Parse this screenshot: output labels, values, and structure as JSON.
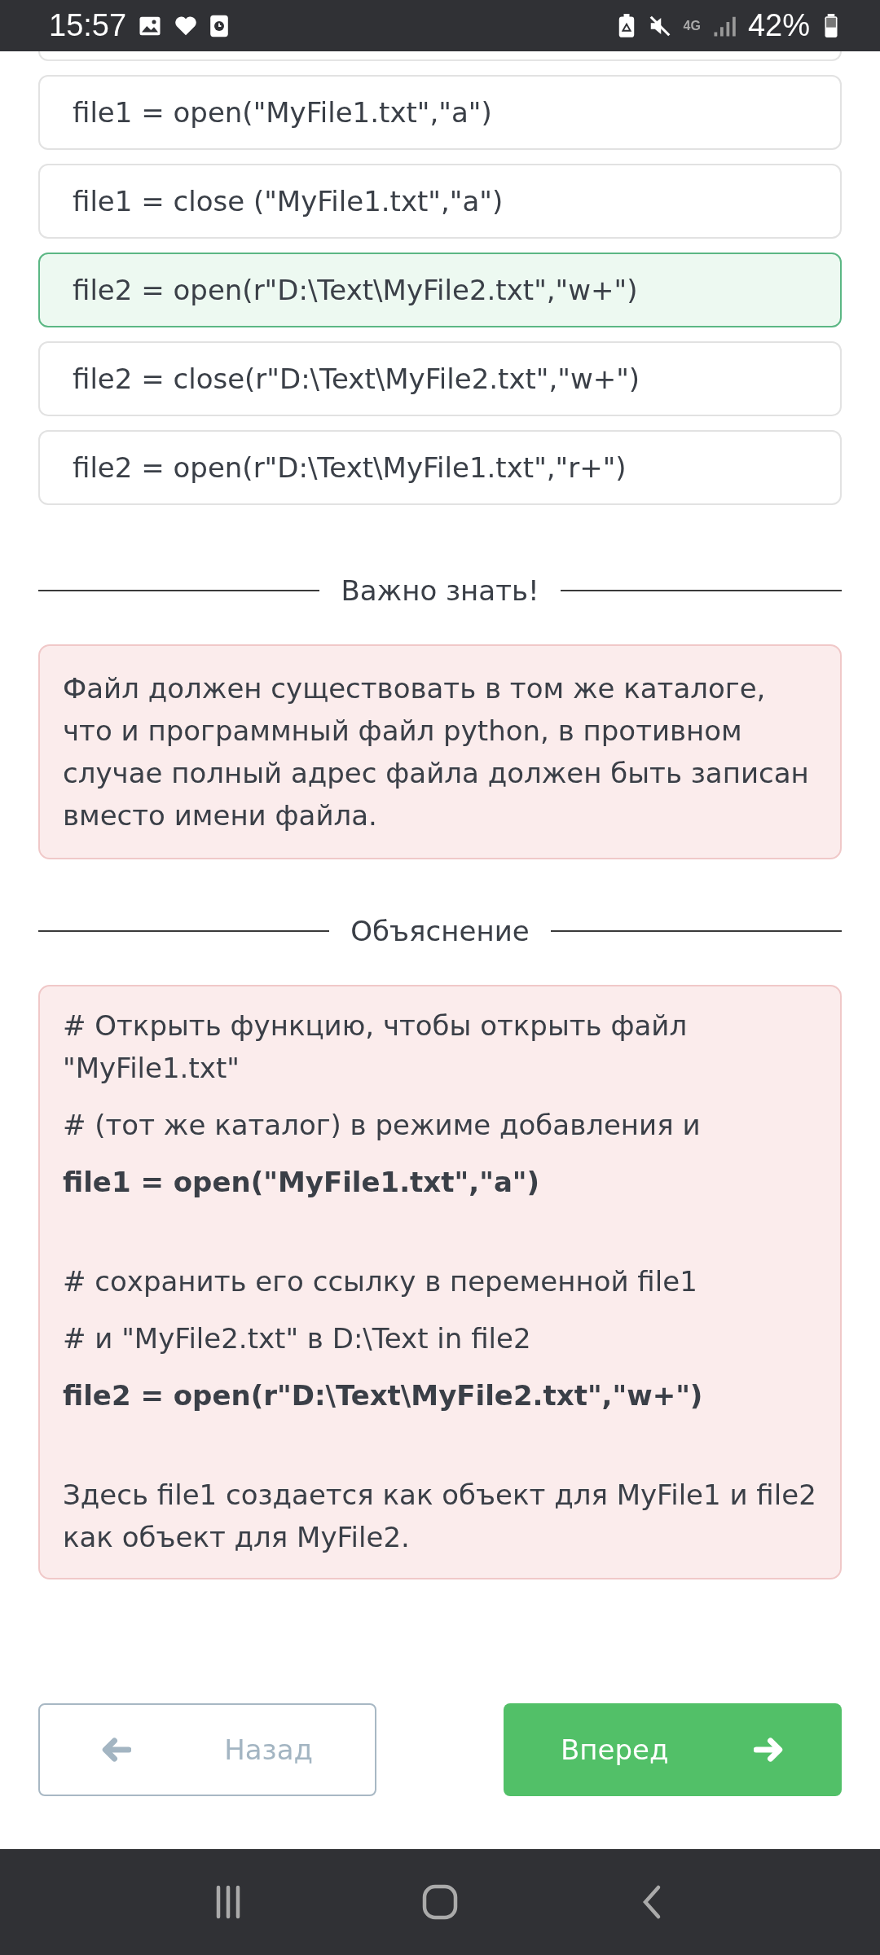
{
  "status_bar": {
    "time": "15:57",
    "network": "4G",
    "battery": "42%"
  },
  "options": [
    {
      "text": "file1 = open(\"MyFile1.txt\",\"a\")",
      "selected": false
    },
    {
      "text": "file1 = close (\"MyFile1.txt\",\"a\")",
      "selected": false
    },
    {
      "text": "file2 = open(r\"D:\\Text\\MyFile2.txt\",\"w+\")",
      "selected": true
    },
    {
      "text": "file2 = close(r\"D:\\Text\\MyFile2.txt\",\"w+\")",
      "selected": false
    },
    {
      "text": "file2 = open(r\"D:\\Text\\MyFile1.txt\",\"r+\")",
      "selected": false
    }
  ],
  "important": {
    "title": "Важно знать!",
    "text": "Файл должен существовать в том же каталоге, что и программный файл python, в противном случае полный адрес файла должен быть записан вместо имени файла."
  },
  "explanation": {
    "title": "Объяснение",
    "paragraphs": [
      [
        {
          "text": "# Открыть функцию, чтобы открыть файл \"MyFile1.txt\"",
          "kind": "comment"
        },
        {
          "text": "# (тот же каталог) в режиме добавления и",
          "kind": "comment"
        },
        {
          "text": "file1 = open(\"MyFile1.txt\",\"a\")",
          "kind": "code"
        }
      ],
      [
        {
          "text": "# сохранить его ссылку в переменной file1",
          "kind": "comment"
        },
        {
          "text": "# и \"MyFile2.txt\" в D:\\Text in file2",
          "kind": "comment"
        },
        {
          "text": "file2 = open(r\"D:\\Text\\MyFile2.txt\",\"w+\")",
          "kind": "code"
        }
      ],
      [
        {
          "text": "Здесь file1 создается как объект для MyFile1 и file2 как объект для MyFile2.",
          "kind": "comment"
        }
      ]
    ]
  },
  "buttons": {
    "back": "Назад",
    "next": "Вперед"
  }
}
